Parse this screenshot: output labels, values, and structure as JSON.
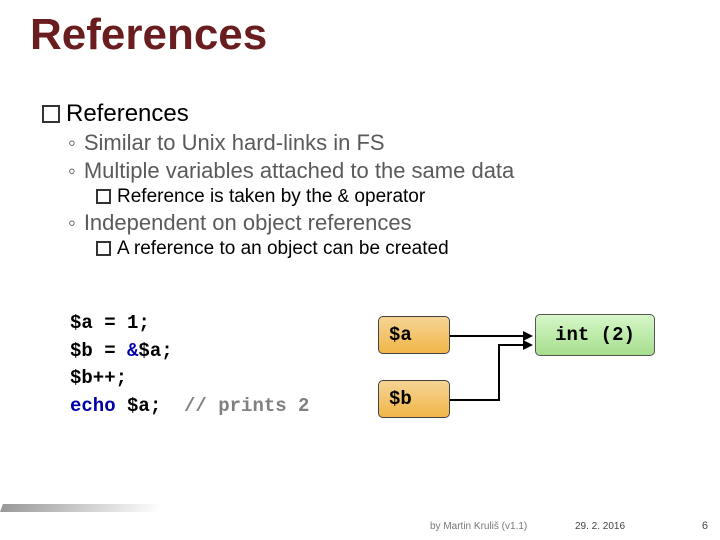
{
  "title": "References",
  "section_heading": "References",
  "bullets": {
    "b1": "Similar to Unix hard-links in FS",
    "b2": "Multiple variables attached to the same data",
    "b2a_pre": "Reference is taken by the ",
    "b2a_code": "&",
    "b2a_post": " operator",
    "b3": "Independent on object references",
    "b3a": "A reference to an object can be created"
  },
  "code": {
    "l1a": "$a = 1;",
    "l2a": "$b = ",
    "l2b": "&",
    "l2c": "$a;",
    "l3a": "$b++;",
    "l4a": "echo",
    "l4b": " $a;  ",
    "l4c": "// prints 2"
  },
  "diagram": {
    "var_a": "$a",
    "var_b": "$b",
    "value": "int (2)"
  },
  "footer": {
    "author": "by Martin Kruliš (v1.1)",
    "date": "29. 2. 2016",
    "page": "6"
  }
}
